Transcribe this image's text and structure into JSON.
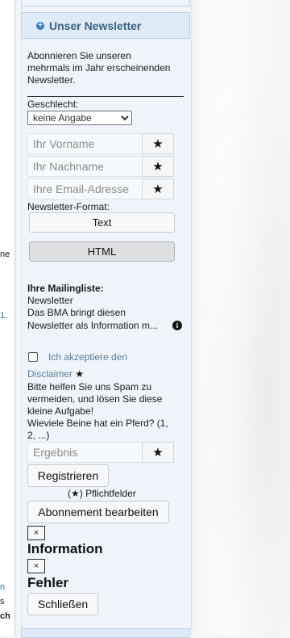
{
  "left_fragments": [
    "ne",
    "1.",
    "n",
    "s",
    "ch"
  ],
  "newsletter": {
    "title": "Unser Newsletter",
    "intro_lines": [
      "Abonnieren Sie unseren",
      "mehrmals im Jahr erscheinenden",
      "Newsletter."
    ],
    "gender_label": "Geschlecht:",
    "gender_value": "keine Angabe",
    "firstname_placeholder": "Ihr Vorname",
    "lastname_placeholder": "Ihr Nachname",
    "email_placeholder": "Ihre Email-Adresse",
    "required_star": "★",
    "format_label": "Newsletter-Format:",
    "format_text": "Text",
    "format_html": "HTML",
    "mailing_heading": "Ihre Mailingliste:",
    "mailing_name": "Newsletter",
    "mailing_desc_lines": [
      "Das BMA bringt diesen",
      "Newsletter als Information m..."
    ],
    "info_icon": "i",
    "accept_label": "Ich akzeptiere den",
    "disclaimer_link": "Disclaimer",
    "spam_lines": [
      "Bitte helfen Sie uns Spam zu",
      "vermeiden, und lösen Sie diese",
      "kleine Aufgabe!"
    ],
    "question_lines": [
      "Wieviele Beine hat ein Pferd? (1,",
      "2, ...)"
    ],
    "result_placeholder": "Ergebnis",
    "register_button": "Registrieren",
    "required_note": "(★) Pflichtfelder",
    "edit_button": "Abonnement bearbeiten",
    "close_x": "×",
    "info_title": "Information",
    "error_title": "Fehler",
    "close_button": "Schließen"
  }
}
